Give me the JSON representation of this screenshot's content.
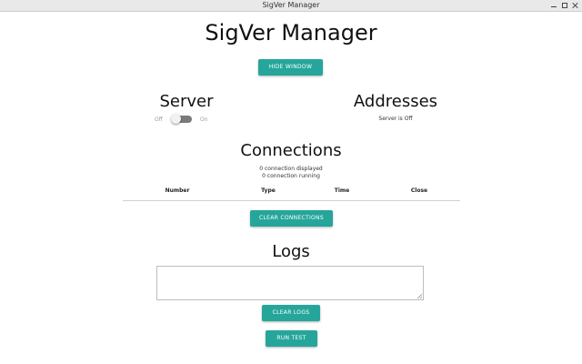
{
  "window": {
    "title": "SigVer Manager"
  },
  "header": {
    "title": "SigVer Manager",
    "hide_window_label": "HIDE WINDOW"
  },
  "server": {
    "title": "Server",
    "switch": {
      "off_label": "Off",
      "on_label": "On",
      "state": "off"
    }
  },
  "addresses": {
    "title": "Addresses",
    "status": "Server is Off"
  },
  "connections": {
    "title": "Connections",
    "displayed_text": "0 connection displayed",
    "running_text": "0 connection running",
    "columns": [
      "Number",
      "Type",
      "Time",
      "Close"
    ],
    "rows": [],
    "clear_label": "CLEAR CONNECTIONS"
  },
  "logs": {
    "title": "Logs",
    "content": "",
    "clear_label": "CLEAR LOGS",
    "run_test_label": "RUN TEST"
  },
  "colors": {
    "accent": "#26a69a",
    "switch_track": "#7a7a7a"
  }
}
